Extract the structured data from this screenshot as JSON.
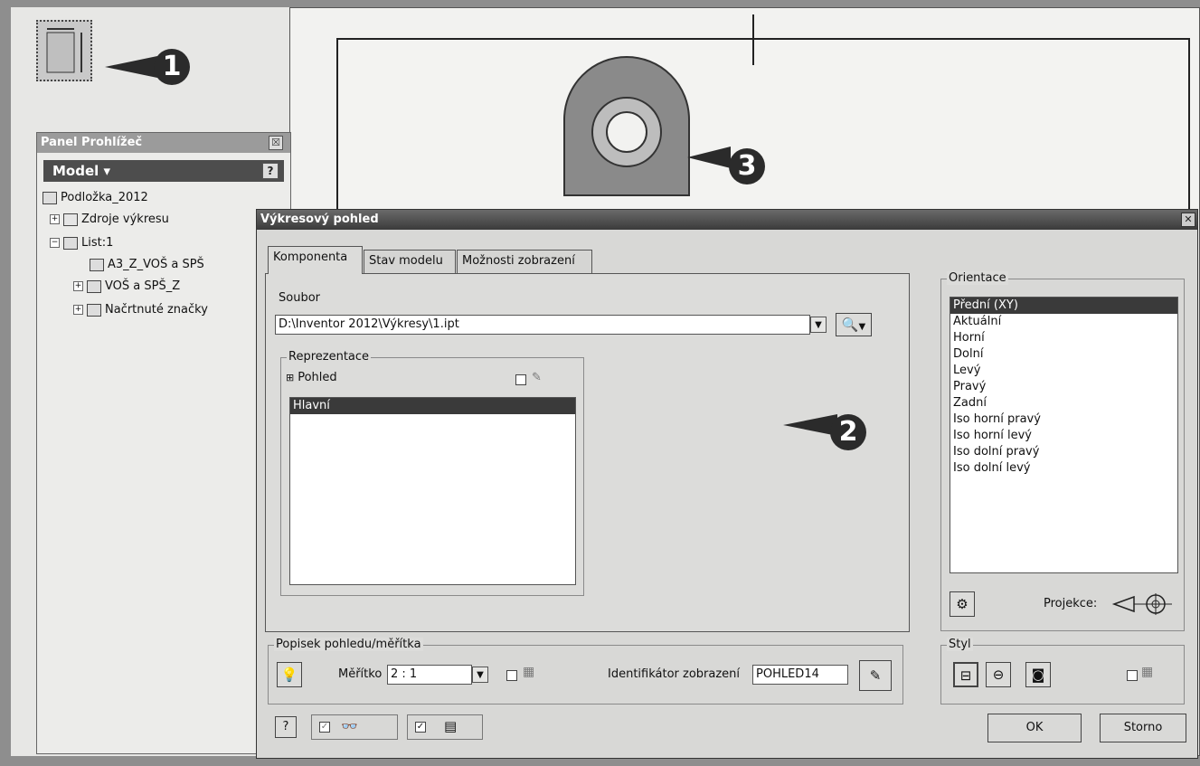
{
  "panel": {
    "title": "Panel Prohlížeč",
    "close": "☒",
    "model_label": "Model ▾",
    "help": "?",
    "tree": [
      {
        "label": "Podložka_2012"
      },
      {
        "label": "Zdroje výkresu",
        "expander": "+"
      },
      {
        "label": "List:1",
        "expander": "−"
      },
      {
        "label": "A3_Z_VOŠ a SPŠ"
      },
      {
        "label": "VOŠ a SPŠ_Z",
        "expander": "+"
      },
      {
        "label": "Načrtnuté značky",
        "expander": "+"
      }
    ]
  },
  "markers": {
    "m1": "1",
    "m2": "2",
    "m3": "3"
  },
  "dialog": {
    "title": "Výkresový pohled",
    "close": "✕",
    "tabs": [
      "Komponenta",
      "Stav modelu",
      "Možnosti zobrazení"
    ],
    "active_tab": "Komponenta",
    "file_label": "Soubor",
    "file_value": "D:\\Inventor 2012\\Výkresy\\1.ipt",
    "representation": {
      "title": "Reprezentace",
      "view_label": "Pohled",
      "items": [
        "Hlavní"
      ],
      "selected": "Hlavní"
    },
    "orientation": {
      "title": "Orientace",
      "items": [
        "Přední (XY)",
        "Aktuální",
        "Horní",
        "Dolní",
        "Levý",
        "Pravý",
        "Zadní",
        "Iso horní pravý",
        "Iso horní levý",
        "Iso dolní pravý",
        "Iso dolní levý"
      ],
      "selected": "Přední (XY)",
      "projection_label": "Projekce:"
    },
    "label_group": {
      "title": "Popisek pohledu/měřítka",
      "scale_label": "Měřítko",
      "scale_value": "2 : 1",
      "identifier_label": "Identifikátor zobrazení",
      "identifier_value": "POHLED14"
    },
    "style": {
      "title": "Styl"
    },
    "buttons": {
      "ok": "OK",
      "cancel": "Storno",
      "help": "?"
    }
  },
  "colors": {
    "selected": "#3a3a3a",
    "title_bar": "#3b3b3b",
    "marker": "#2b2b2b"
  }
}
